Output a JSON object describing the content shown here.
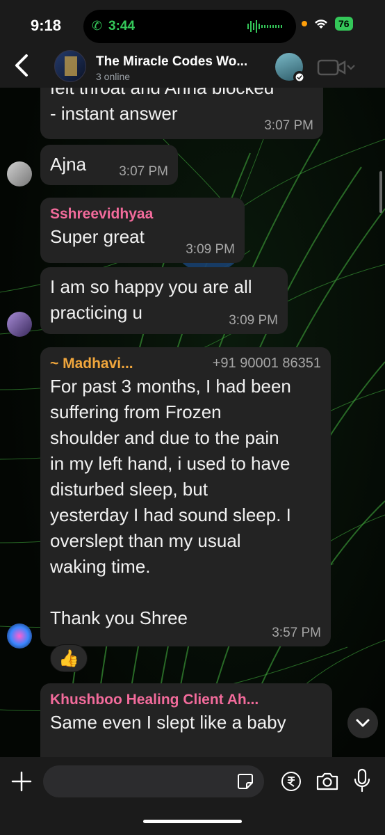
{
  "status_bar": {
    "time": "9:18",
    "call_time": "3:44",
    "battery": "76"
  },
  "header": {
    "title": "The Miracle Codes Wo...",
    "subtitle": "3 online"
  },
  "messages": [
    {
      "text": "felt throat and Anna blocked\n- instant answer",
      "time": "3:07 PM"
    },
    {
      "text": "Ajna",
      "time": "3:07 PM"
    },
    {
      "sender": "Sshreevidhyaa",
      "text": "Super great",
      "time": "3:09 PM"
    },
    {
      "text": "I am so happy you are all\npracticing u",
      "time": "3:09 PM"
    },
    {
      "sender": "~ Madhavi...",
      "phone": "+91 90001 86351",
      "text": "For past 3 months, I had been\nsuffering from Frozen\nshoulder and due to the pain\nin my left hand, i used to have\ndisturbed sleep, but\nyesterday I had sound sleep. I\noverslept than my usual\nwaking time.\n\nThank you Shree",
      "time": "3:57 PM",
      "reaction": "👍"
    },
    {
      "sender": "Khushboo Healing Client Ah...",
      "text": "Same even I slept like a baby"
    }
  ],
  "colors": {
    "sender_pink": "#f26b9b",
    "sender_orange": "#f0a63c",
    "bubble": "#232323",
    "accent_green": "#34c759"
  },
  "input": {
    "placeholder": ""
  }
}
